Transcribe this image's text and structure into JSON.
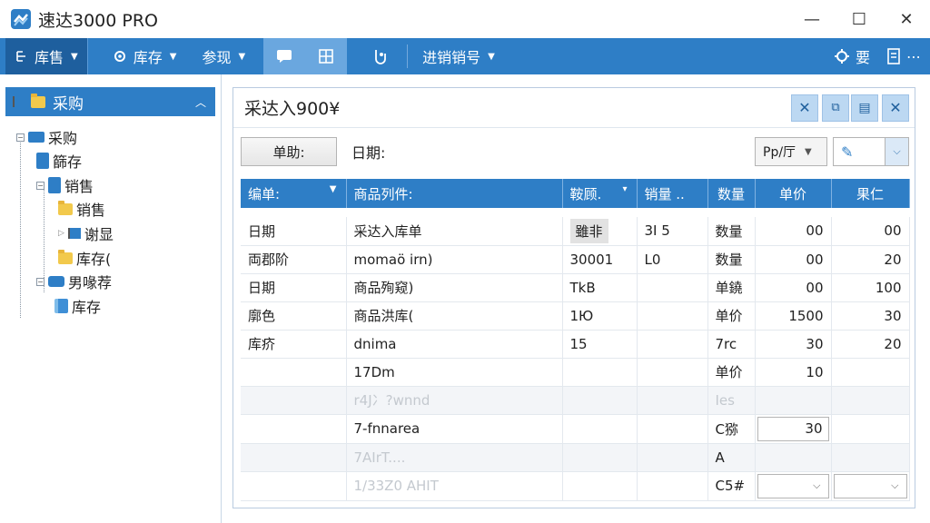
{
  "window": {
    "title": "速达3000 PRO",
    "minimize": "—",
    "maximize": "☐",
    "close": "✕"
  },
  "toolbar": {
    "items": [
      {
        "label": "库售",
        "icon": "tree-icon"
      },
      {
        "label": "库存",
        "icon": "gear-icon"
      },
      {
        "label": "参现",
        "icon": ""
      },
      {
        "label": "进销销号",
        "icon": ""
      }
    ],
    "right_label": "要",
    "more": "⋯"
  },
  "tree": {
    "header": "采购",
    "nodes": [
      {
        "label": "采购",
        "icon": "book-icon"
      },
      {
        "label": "篩存",
        "icon": "book-icon"
      },
      {
        "label": "销售",
        "icon": "doc-icon"
      },
      {
        "label": "销售",
        "icon": "folder-icon"
      },
      {
        "label": "谢显",
        "icon": "flag-icon"
      },
      {
        "label": "库存(",
        "icon": "folder-icon"
      },
      {
        "label": "男喙荐",
        "icon": "truck-icon"
      },
      {
        "label": "库存",
        "icon": "cube-icon"
      }
    ]
  },
  "doc": {
    "title": "采达入900¥",
    "button_label": "单助:",
    "date_label": "日期:",
    "dropdown_value": "Pp/厅",
    "columns": [
      "编单:",
      "商品列件:",
      "鞍顾.",
      "销量 ..",
      "数量",
      "单价",
      "果仁"
    ],
    "rows": [
      [
        "日期",
        "采达入库单",
        "雖非",
        "3I 5",
        "数量",
        "00",
        "00"
      ],
      [
        "両郡阶",
        "momaö irn)",
        "30001",
        "L0",
        "数量",
        "00",
        "20"
      ],
      [
        "日期",
        "商品殉窥)",
        "TkB",
        "",
        "单鐃",
        "00",
        "100"
      ],
      [
        "廓色",
        "商品洪库(",
        "1Ю",
        "",
        "单价",
        "1500",
        "30"
      ],
      [
        "库疥",
        "dnima",
        "15",
        "",
        "7rc",
        "30",
        "20"
      ],
      [
        "",
        "17Dm",
        "",
        "",
        "单价",
        "10",
        ""
      ],
      [
        "",
        "r4J冫?wnnd",
        "",
        "",
        "Ies",
        "",
        ""
      ],
      [
        "",
        "7-fnnarea",
        "",
        "",
        "C猕",
        "30",
        ""
      ],
      [
        "",
        "7AIrT....",
        "",
        "",
        "A",
        "",
        ""
      ],
      [
        "",
        "1/33Z0 AHIT",
        "",
        "",
        "C5#",
        "",
        ""
      ]
    ]
  }
}
